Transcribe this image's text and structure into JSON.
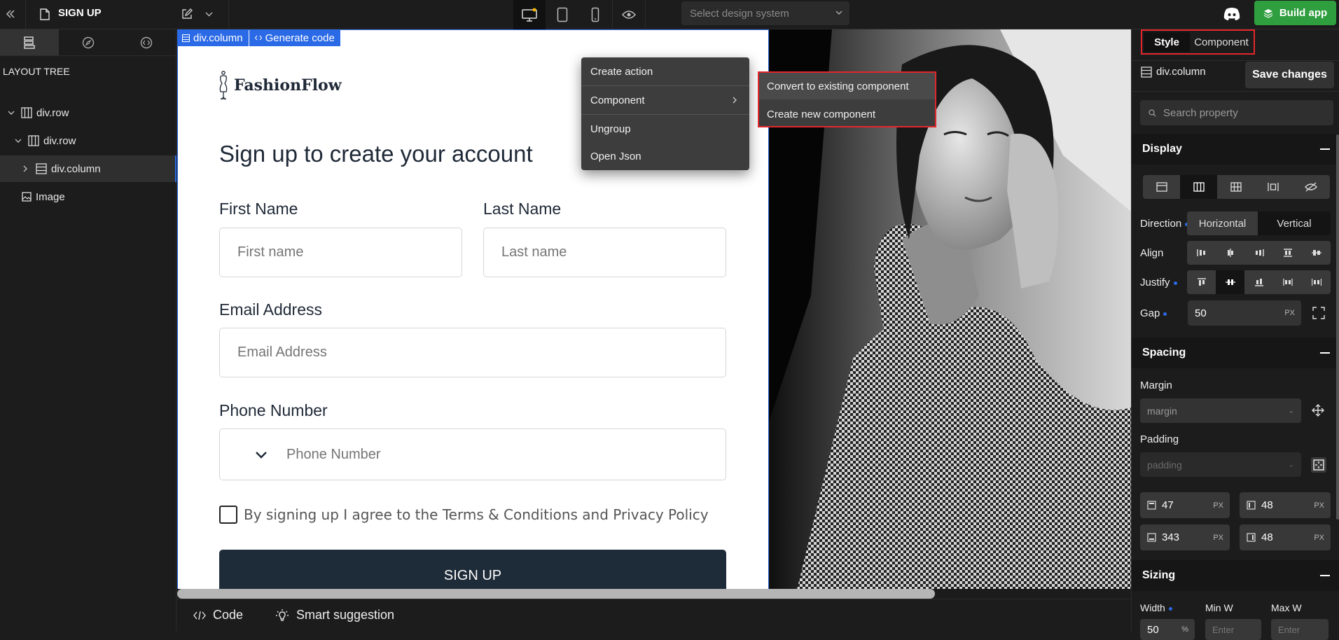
{
  "topbar": {
    "page_title": "SIGN UP",
    "design_system_placeholder": "Select design system",
    "build_label": "Build app"
  },
  "left_panel": {
    "section_title": "LAYOUT TREE",
    "tree": [
      {
        "label": "div.row"
      },
      {
        "label": "div.row"
      },
      {
        "label": "div.column"
      },
      {
        "label": "Image"
      }
    ]
  },
  "selection": {
    "tag": "div.column",
    "generate_label": "Generate code"
  },
  "form": {
    "brand": "FashionFlow",
    "heading": "Sign up to create your account",
    "first_name_label": "First Name",
    "first_name_placeholder": "First name",
    "last_name_label": "Last Name",
    "last_name_placeholder": "Last name",
    "email_label": "Email Address",
    "email_placeholder": "Email Address",
    "phone_label": "Phone Number",
    "phone_placeholder": "Phone Number",
    "agree_text": "By signing up I agree to the Terms & Conditions and Privacy Policy",
    "submit_label": "SIGN UP"
  },
  "context_menu": {
    "items": [
      "Create action",
      "Component",
      "Ungroup",
      "Open Json"
    ],
    "submenu": [
      "Convert to existing component",
      "Create new component"
    ]
  },
  "bottombar": {
    "code_label": "Code",
    "suggest_label": "Smart suggestion"
  },
  "right_panel": {
    "tabs": [
      "Style",
      "Component"
    ],
    "element_tag": "div.column",
    "save_label": "Save changes",
    "search_placeholder": "Search property",
    "display_title": "Display",
    "direction_label": "Direction",
    "direction_options": [
      "Horizontal",
      "Vertical"
    ],
    "align_label": "Align",
    "justify_label": "Justify",
    "gap_label": "Gap",
    "gap_value": "50",
    "unit": "PX",
    "spacing_title": "Spacing",
    "margin_label": "Margin",
    "margin_placeholder": "margin",
    "padding_label": "Padding",
    "padding_placeholder": "padding",
    "dash": "-",
    "padding_values": [
      "47",
      "48",
      "343",
      "48"
    ],
    "sizing_title": "Sizing",
    "width_label": "Width",
    "minw_label": "Min W",
    "maxw_label": "Max W",
    "width_value": "50",
    "width_unit": "%",
    "enter_placeholder": "Enter"
  },
  "colors": {
    "accent_blue": "#2b6ae6",
    "build_green": "#2e9e3e",
    "highlight_red": "#e3272c",
    "submit_navy": "#1e2b38"
  }
}
